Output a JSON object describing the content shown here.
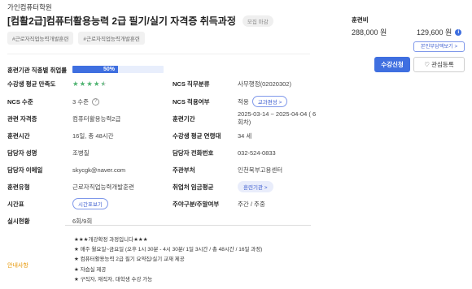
{
  "header": {
    "org": "가인컴퓨터학원",
    "title": "[컴활2급]컴퓨터활용능력 2급 필기/실기 자격증 취득과정",
    "status_badge": "모집 마감",
    "tags": [
      "#근로자직업능력개발훈련",
      "#근로자직업능력개발훈련"
    ]
  },
  "details": {
    "employment_rate_label": "훈련기관 직종별 취업률",
    "employment_rate_value": 50,
    "employment_rate_text": "50%",
    "satisfaction_label": "수강생 평균 만족도",
    "satisfaction_stars": 4.5,
    "ncs_duty_label": "NCS 직무분류",
    "ncs_duty_value": "사무행정(02020302)",
    "ncs_level_label": "NCS 수준",
    "ncs_level_value": "3 수준",
    "ncs_apply_label": "NCS 적용여부",
    "ncs_apply_value": "적용",
    "ncs_apply_button": "교과편성 >",
    "cert_label": "관련 자격증",
    "cert_value": "컴퓨터활용능력2급",
    "period_label": "훈련기간",
    "period_value": "2025-03-14 ~ 2025-04-04 ( 6회차)",
    "hours_label": "훈련시간",
    "hours_value": "16일, 총 48시간",
    "age_label": "수강생 평균 연령대",
    "age_value": "34 세",
    "manager_label": "담당자 성명",
    "manager_value": "조병질",
    "phone_label": "담당자 전화번호",
    "phone_value": "032-524-0833",
    "email_label": "담당자 이메일",
    "email_value": "skycgk@naver.com",
    "dept_label": "주관부처",
    "dept_value": "인천북부고용센터",
    "type_label": "훈련유형",
    "type_value": "근로자직업능력개발훈련",
    "wage_label": "취업처 임금평균",
    "wage_button": "훈련기관 >",
    "schedule_label": "시간표",
    "schedule_button": "시간표보기",
    "dayweek_label": "주야구분/주말여부",
    "dayweek_value": "주간 / 주중",
    "status_label": "실시현황",
    "status_value": "6회/9회"
  },
  "notice": {
    "label": "안내사항",
    "lines": [
      "★★★개강확정 과정입니다★★★",
      "★ 매주 월요일~금요일 (오후 1시 30분 - 4시 30분/ 1일 3시간 / 총 48시간 / 16일 과정)",
      "★ 컴퓨터활용능력 2급 필기 요약집/실기 교재 제공",
      "★ 자습실 제공",
      "★ 구직자, 재직자, 대학생 수강 가능"
    ]
  },
  "side": {
    "fee_label": "훈련비",
    "fee_price": "288,000 원",
    "fee_price2": "129,600 원",
    "self_pay_button": "본인부담액보기 >",
    "apply_button": "수강신청",
    "favorite_button": "관심등록"
  },
  "colors": {
    "accent": "#3f6fe0",
    "star": "#4fb371",
    "notice": "#e69500"
  }
}
